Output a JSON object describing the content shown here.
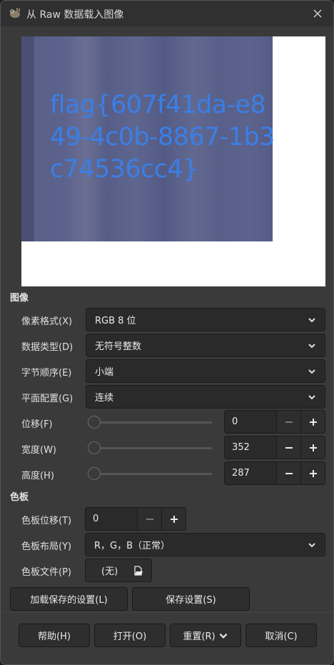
{
  "window": {
    "title": "从 Raw 数据载入图像"
  },
  "preview": {
    "image_text": "flag{607f41da-e849-4c0b-8867-1b3c74536cc4}"
  },
  "image_section": {
    "title": "图像",
    "pixel_format": {
      "label": "像素格式(X)",
      "value": "RGB 8 位"
    },
    "data_type": {
      "label": "数据类型(D)",
      "value": "无符号整数"
    },
    "byte_order": {
      "label": "字节顺序(E)",
      "value": "小端"
    },
    "planar_config": {
      "label": "平面配置(G)",
      "value": "连续"
    },
    "offset": {
      "label": "位移(F)",
      "value": "0"
    },
    "width": {
      "label": "宽度(W)",
      "value": "352"
    },
    "height": {
      "label": "高度(H)",
      "value": "287"
    }
  },
  "palette_section": {
    "title": "色板",
    "palette_offset": {
      "label": "色板位移(T)",
      "value": "0"
    },
    "palette_layout": {
      "label": "色板布局(Y)",
      "value": "R，G，B（正常）"
    },
    "palette_file": {
      "label": "色板文件(P)",
      "value": "(无)"
    }
  },
  "settings_buttons": {
    "load": "加载保存的设置(L)",
    "save": "保存设置(S)"
  },
  "footer": {
    "help": "帮助(H)",
    "open": "打开(O)",
    "reset": "重置(R)",
    "cancel": "取消(C)"
  },
  "icons": {
    "app": "gimp-wilber-icon",
    "close": "close-icon",
    "chevron": "chevron-down-icon",
    "minus": "minus-icon",
    "plus": "plus-icon",
    "file": "document-open-icon"
  },
  "colors": {
    "flag_text": "#3a7fe6",
    "dialog_bg": "#3a3a3a"
  }
}
